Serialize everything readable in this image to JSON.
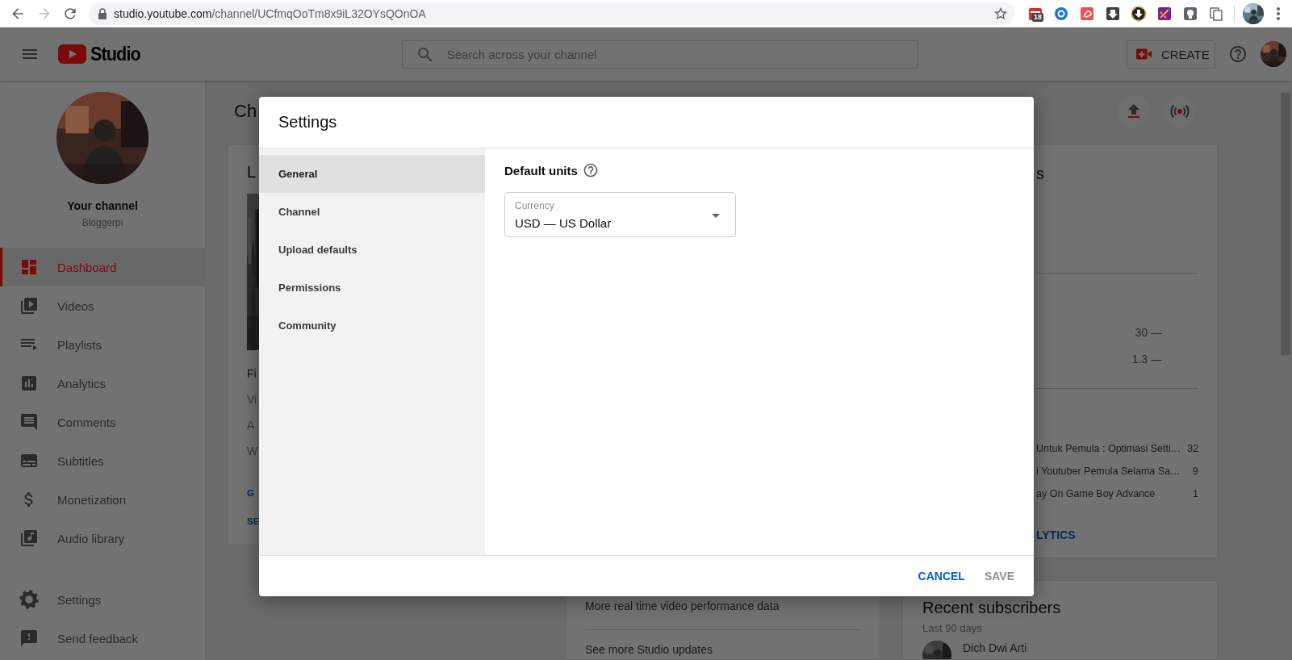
{
  "browser": {
    "url": "studio.youtube.com/channel/UCfmqOoTm8x9iL32OYsQOnOA",
    "extensions": [
      {
        "kind": "calendar",
        "badge": "18"
      },
      {
        "kind": "ring"
      },
      {
        "kind": "tile"
      },
      {
        "kind": "download"
      },
      {
        "kind": "disc"
      },
      {
        "kind": "sword"
      },
      {
        "kind": "bulb"
      },
      {
        "kind": "pages"
      }
    ]
  },
  "header": {
    "logo": "Studio",
    "search": {
      "placeholder": "Search across your channel"
    },
    "create": "CREATE"
  },
  "sidebar": {
    "channel_label": "Your channel",
    "channel_name": "Bloggerpi",
    "items": [
      {
        "kind": "dashboard",
        "label": "Dashboard",
        "selected": true
      },
      {
        "kind": "videos",
        "label": "Videos",
        "selected": false
      },
      {
        "kind": "playlists",
        "label": "Playlists",
        "selected": false
      },
      {
        "kind": "analytics",
        "label": "Analytics",
        "selected": false
      },
      {
        "kind": "comments",
        "label": "Comments",
        "selected": false
      },
      {
        "kind": "subtitles",
        "label": "Subtitles",
        "selected": false
      },
      {
        "kind": "monetization",
        "label": "Monetization",
        "selected": false
      },
      {
        "kind": "audio",
        "label": "Audio library",
        "selected": false
      }
    ],
    "footer_items": [
      {
        "kind": "settings",
        "label": "Settings"
      },
      {
        "kind": "feedback",
        "label": "Send feedback"
      }
    ]
  },
  "page": {
    "title": "Ch",
    "latest_video_card": {
      "title": "L",
      "video_title": "Fi",
      "stats": [
        "Vi",
        "A",
        "W"
      ],
      "links": [
        "G",
        "SE"
      ]
    },
    "news_card": {
      "items": [
        "More real time video performance data",
        "See more Studio updates"
      ]
    },
    "analytics_card": {
      "title": "s",
      "stats": [
        "30 —",
        "1.3 —"
      ],
      "top_videos": [
        {
          "title": "Untuk Pemula : Optimasi Setti…",
          "views": "32"
        },
        {
          "title": "i Youtuber Pemula Selama Sa…",
          "views": "9"
        },
        {
          "title": "ay On Game Boy Advance",
          "views": "1"
        }
      ],
      "link": "LYTICS"
    },
    "subscribers_card": {
      "title": "Recent subscribers",
      "subtitle": "Last 90 days",
      "subscribers": [
        {
          "name": "Dich Dwi Arti"
        }
      ]
    }
  },
  "dialog": {
    "title": "Settings",
    "nav": [
      {
        "label": "General",
        "selected": true
      },
      {
        "label": "Channel",
        "selected": false
      },
      {
        "label": "Upload defaults",
        "selected": false
      },
      {
        "label": "Permissions",
        "selected": false
      },
      {
        "label": "Community",
        "selected": false
      }
    ],
    "section_title": "Default units",
    "currency": {
      "label": "Currency",
      "value": "USD — US Dollar"
    },
    "buttons": [
      {
        "label": "CANCEL",
        "disabled": false
      },
      {
        "label": "SAVE",
        "disabled": true
      }
    ]
  }
}
